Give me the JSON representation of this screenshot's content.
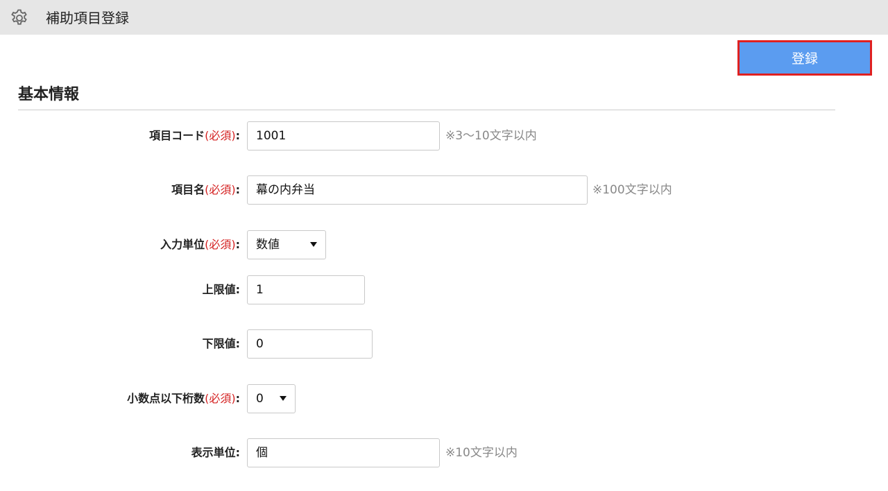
{
  "header": {
    "title": "補助項目登録",
    "icon": "gear-icon"
  },
  "toolbar": {
    "register_label": "登録",
    "register_color": "#5b9cf0",
    "highlight_color": "#e02020"
  },
  "section": {
    "title": "基本情報"
  },
  "form": {
    "required_mark": "(必須)",
    "colon": ":",
    "item_code": {
      "label": "項目コード",
      "value": "1001",
      "hint": "※3〜10文字以内"
    },
    "item_name": {
      "label": "項目名",
      "value": "幕の内弁当",
      "hint": "※100文字以内"
    },
    "input_unit": {
      "label": "入力単位",
      "value": "数値"
    },
    "upper_limit": {
      "label": "上限値",
      "value": "1"
    },
    "lower_limit": {
      "label": "下限値",
      "value": "0"
    },
    "decimal_places": {
      "label": "小数点以下桁数",
      "value": "0"
    },
    "display_unit": {
      "label": "表示単位",
      "value": "個",
      "hint": "※10文字以内"
    }
  }
}
